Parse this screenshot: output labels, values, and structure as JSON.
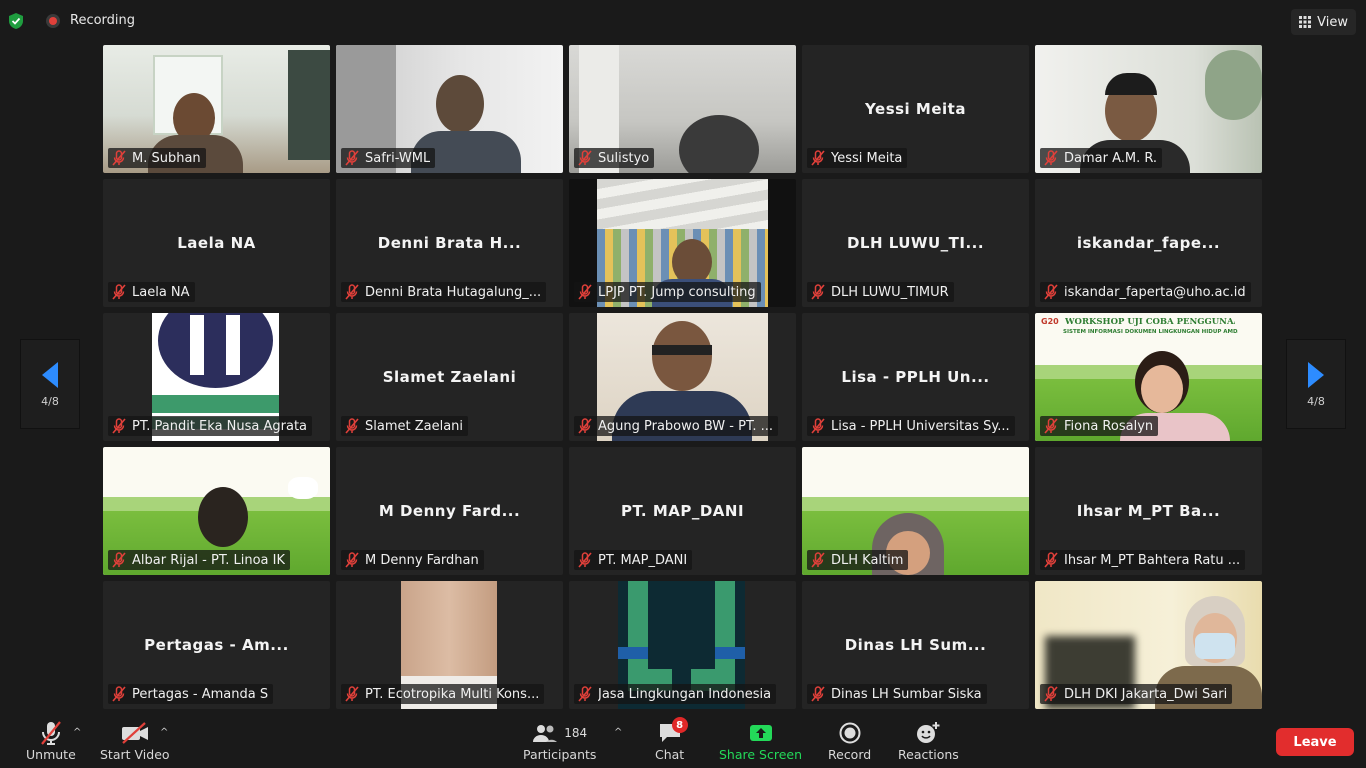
{
  "top": {
    "recording_label": "Recording",
    "view_label": "View"
  },
  "pager": {
    "left_page": "4/8",
    "right_page": "4/8"
  },
  "tiles": [
    {
      "big": "",
      "name": "M. Subhan"
    },
    {
      "big": "",
      "name": "Safri-WML"
    },
    {
      "big": "",
      "name": "Sulistyo"
    },
    {
      "big": "Yessi Meita",
      "name": "Yessi Meita"
    },
    {
      "big": "",
      "name": "Damar A.M. R."
    },
    {
      "big": "Laela NA",
      "name": "Laela NA"
    },
    {
      "big": "Denni Brata H...",
      "name": "Denni Brata Hutagalung_..."
    },
    {
      "big": "",
      "name": "LPJP PT. Jump consulting"
    },
    {
      "big": "DLH LUWU_TI...",
      "name": "DLH LUWU_TIMUR"
    },
    {
      "big": "iskandar_fape...",
      "name": "iskandar_faperta@uho.ac.id"
    },
    {
      "big": "",
      "name": "PT. Pandit Eka Nusa Agrata"
    },
    {
      "big": "Slamet Zaelani",
      "name": "Slamet Zaelani"
    },
    {
      "big": "",
      "name": "Agung Prabowo BW - PT. ..."
    },
    {
      "big": "Lisa - PPLH Un...",
      "name": "Lisa - PPLH Universitas Sy..."
    },
    {
      "big": "",
      "name": "Fiona Rosalyn"
    },
    {
      "big": "",
      "name": "Albar Rijal - PT. Linoa IK"
    },
    {
      "big": "M Denny Fard...",
      "name": "M Denny Fardhan"
    },
    {
      "big": "PT. MAP_DANI",
      "name": "PT. MAP_DANI"
    },
    {
      "big": "",
      "name": "DLH Kaltim"
    },
    {
      "big": "Ihsar M_PT Ba...",
      "name": "Ihsar M_PT Bahtera Ratu ..."
    },
    {
      "big": "Pertagas - Am...",
      "name": "Pertagas - Amanda S"
    },
    {
      "big": "",
      "name": "PT. Ecotropika Multi Kons..."
    },
    {
      "big": "",
      "name": "Jasa Lingkungan Indonesia"
    },
    {
      "big": "Dinas LH Sum...",
      "name": "Dinas LH Sumbar Siska"
    },
    {
      "big": "",
      "name": "DLH DKI Jakarta_Dwi Sari"
    }
  ],
  "workshop_banner": {
    "title": "WORKSHOP UJI COBA PENGGUNAAN",
    "subtitle": "SISTEM INFORMASI DOKUMEN LINGKUNGAN HIDUP AMDALNET",
    "logo_text": "G20"
  },
  "toolbar": {
    "unmute": "Unmute",
    "start_video": "Start Video",
    "participants_count": "184",
    "participants": "Participants",
    "chat": "Chat",
    "chat_badge": "8",
    "share_screen": "Share Screen",
    "record": "Record",
    "reactions": "Reactions",
    "leave": "Leave"
  },
  "colors": {
    "share_green": "#23d959",
    "leave_red": "#e22d2d",
    "pager_arrow": "#2d8cff",
    "muted_red": "#e0403a"
  }
}
